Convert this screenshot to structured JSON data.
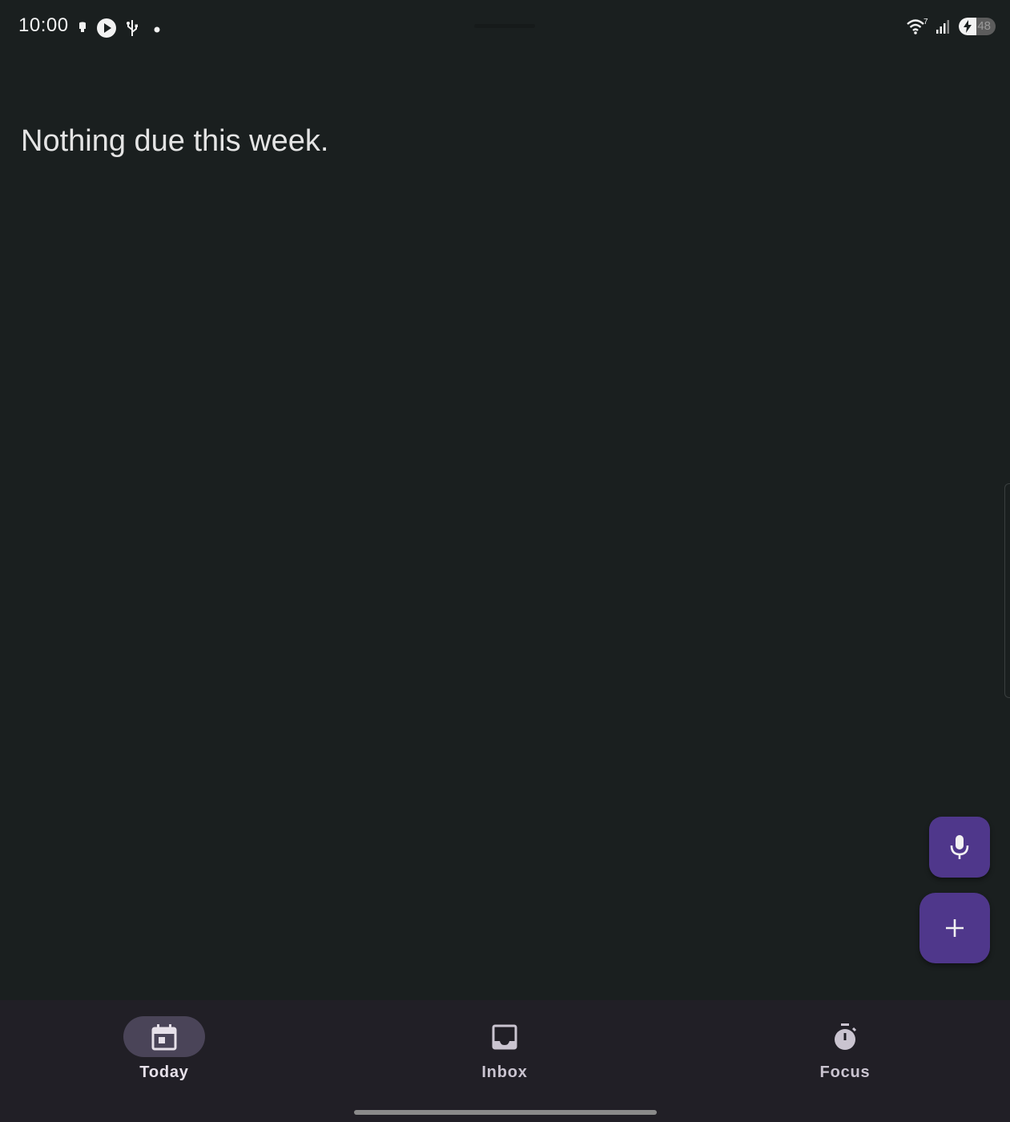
{
  "status_bar": {
    "time": "10:00",
    "battery_level": "48",
    "battery_fraction": 0.48,
    "wifi_badge": "7",
    "left_icons": [
      "notification-icon",
      "play-icon",
      "usb-icon",
      "dot-icon"
    ],
    "right_icons": [
      "wifi-icon",
      "signal-icon",
      "battery-icon"
    ]
  },
  "main": {
    "empty_message": "Nothing due this week."
  },
  "fabs": {
    "mic_icon": "mic-icon",
    "add_icon": "plus-icon",
    "color": "#4f378b"
  },
  "bottom_nav": {
    "items": [
      {
        "label": "Today",
        "icon": "calendar-today-icon",
        "active": true
      },
      {
        "label": "Inbox",
        "icon": "inbox-icon",
        "active": false
      },
      {
        "label": "Focus",
        "icon": "timer-icon",
        "active": false
      }
    ]
  },
  "colors": {
    "background": "#1a1f1f",
    "nav_background": "#211f26",
    "active_indicator": "#4a4458",
    "accent": "#4f378b"
  }
}
